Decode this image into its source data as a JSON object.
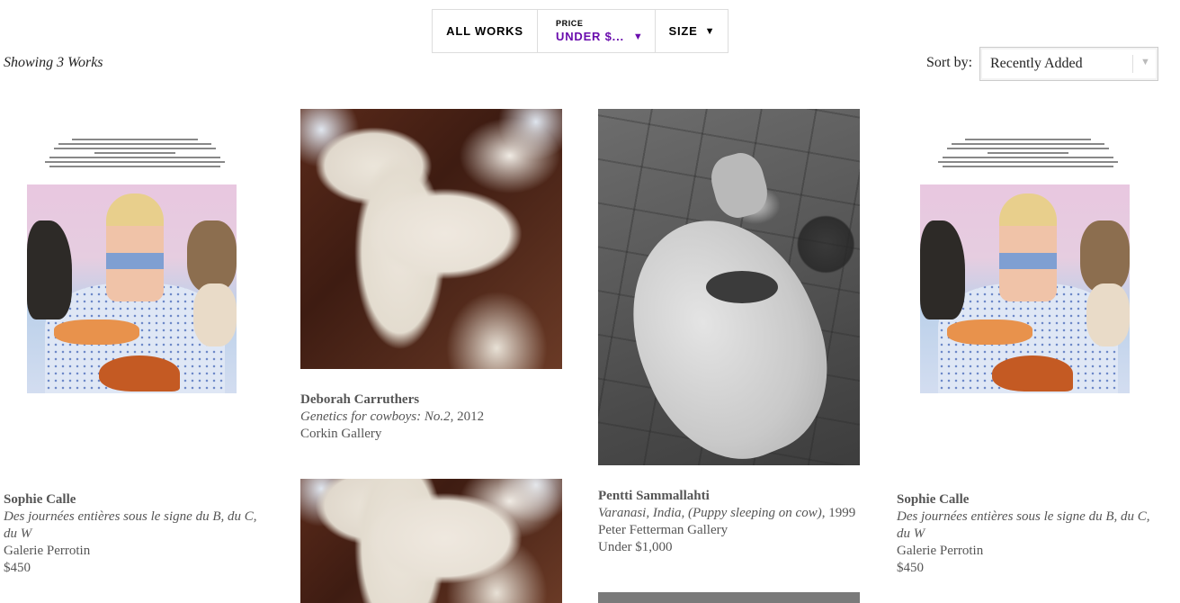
{
  "filters": {
    "all_works": "ALL WORKS",
    "price_label": "PRICE",
    "price_value": "UNDER $...",
    "size_label": "SIZE"
  },
  "results": {
    "showing": "Showing 3 Works"
  },
  "sort": {
    "label": "Sort by:",
    "value": "Recently Added"
  },
  "artworks": [
    {
      "artist": "Sophie Calle",
      "title": "Des journées entières sous le signe du B, du C, du W",
      "year": "",
      "gallery": "Galerie Perrotin",
      "price": "$450"
    },
    {
      "artist": "Deborah Carruthers",
      "title": "Genetics for cowboys: No.2",
      "year": ", 2012",
      "gallery": "Corkin Gallery",
      "price": ""
    },
    {
      "artist": "Pentti Sammallahti",
      "title": "Varanasi, India, (Puppy sleeping on cow)",
      "year": ", 1999",
      "gallery": "Peter Fetterman Gallery",
      "price": "Under $1,000"
    },
    {
      "artist": "Sophie Calle",
      "title": "Des journées entières sous le signe du B, du C, du W",
      "year": "",
      "gallery": "Galerie Perrotin",
      "price": "$450"
    }
  ],
  "icons": {
    "price_arrow": "caret-down-icon",
    "size_arrow": "caret-down-icon",
    "sort_arrow": "caret-down-icon"
  },
  "colors": {
    "accent": "#6a0dad",
    "text": "#555555",
    "border": "#dddddd"
  }
}
